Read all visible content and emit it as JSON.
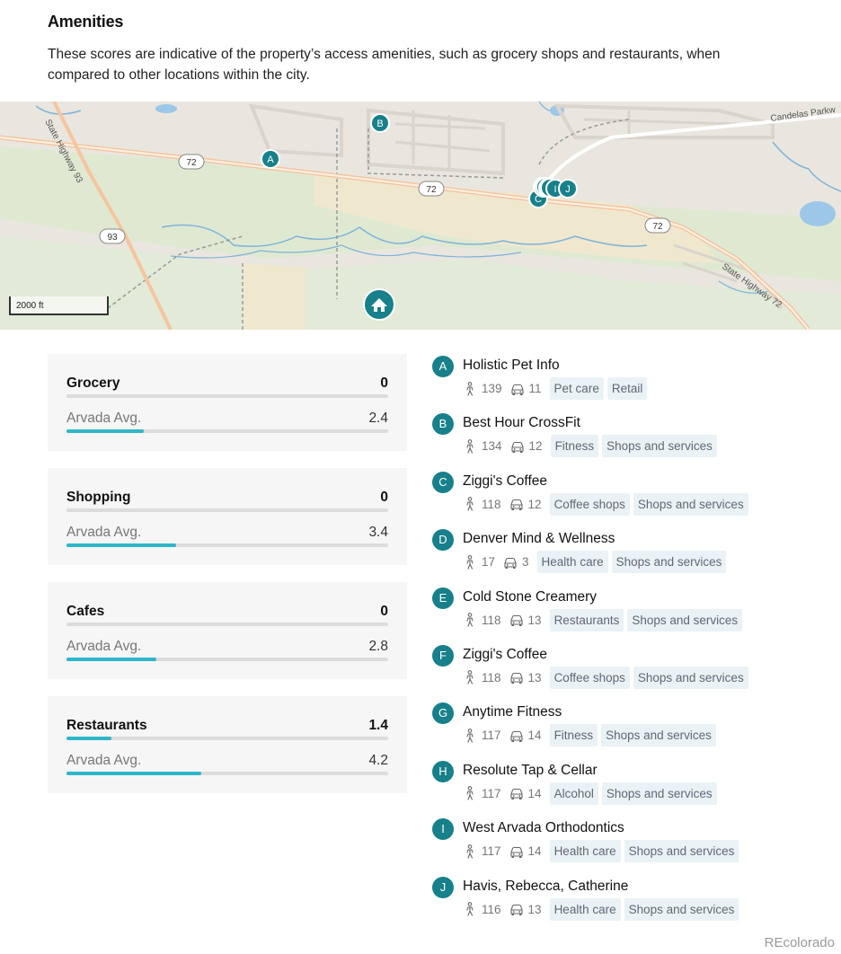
{
  "header": {
    "title": "Amenities",
    "description": "These scores are indicative of the property’s access amenities, such as grocery shops and restaurants, when compared to other locations within the city."
  },
  "map": {
    "scale_label": "2000 ft",
    "road_labels": [
      "72",
      "72",
      "72",
      "93",
      "State Highway 93",
      "State Highway 72",
      "Candelas Parkway"
    ],
    "markers": [
      "A",
      "B",
      "C",
      "D",
      "E",
      "F",
      "G",
      "H",
      "I",
      "J"
    ]
  },
  "scores": [
    {
      "category": "Grocery",
      "value": "0",
      "value_num": 0,
      "avg_label": "Arvada Avg.",
      "avg": "2.4",
      "avg_num": 2.4
    },
    {
      "category": "Shopping",
      "value": "0",
      "value_num": 0,
      "avg_label": "Arvada Avg.",
      "avg": "3.4",
      "avg_num": 3.4
    },
    {
      "category": "Cafes",
      "value": "0",
      "value_num": 0,
      "avg_label": "Arvada Avg.",
      "avg": "2.8",
      "avg_num": 2.8
    },
    {
      "category": "Restaurants",
      "value": "1.4",
      "value_num": 1.4,
      "avg_label": "Arvada Avg.",
      "avg": "4.2",
      "avg_num": 4.2
    }
  ],
  "score_max": 10,
  "amenities": [
    {
      "letter": "A",
      "name": "Holistic Pet Info",
      "walk": "139",
      "drive": "11",
      "tags": [
        "Pet care",
        "Retail"
      ]
    },
    {
      "letter": "B",
      "name": "Best Hour CrossFit",
      "walk": "134",
      "drive": "12",
      "tags": [
        "Fitness",
        "Shops and services"
      ]
    },
    {
      "letter": "C",
      "name": "Ziggi's Coffee",
      "walk": "118",
      "drive": "12",
      "tags": [
        "Coffee shops",
        "Shops and services"
      ]
    },
    {
      "letter": "D",
      "name": "Denver Mind & Wellness",
      "walk": "17",
      "drive": "3",
      "tags": [
        "Health care",
        "Shops and services"
      ]
    },
    {
      "letter": "E",
      "name": "Cold Stone Creamery",
      "walk": "118",
      "drive": "13",
      "tags": [
        "Restaurants",
        "Shops and services"
      ]
    },
    {
      "letter": "F",
      "name": "Ziggi's Coffee",
      "walk": "118",
      "drive": "13",
      "tags": [
        "Coffee shops",
        "Shops and services"
      ]
    },
    {
      "letter": "G",
      "name": "Anytime Fitness",
      "walk": "117",
      "drive": "14",
      "tags": [
        "Fitness",
        "Shops and services"
      ]
    },
    {
      "letter": "H",
      "name": "Resolute Tap & Cellar",
      "walk": "117",
      "drive": "14",
      "tags": [
        "Alcohol",
        "Shops and services"
      ]
    },
    {
      "letter": "I",
      "name": "West Arvada Orthodontics",
      "walk": "117",
      "drive": "14",
      "tags": [
        "Health care",
        "Shops and services"
      ]
    },
    {
      "letter": "J",
      "name": "Havis, Rebecca, Catherine",
      "walk": "116",
      "drive": "13",
      "tags": [
        "Health care",
        "Shops and services"
      ]
    }
  ],
  "footer": {
    "brand": "REcolorado"
  },
  "colors": {
    "accent": "#17808a",
    "bar_fill": "#2fb6c8",
    "tag_bg": "#eaf2f5"
  },
  "icons": {
    "walk": "walking-person-icon",
    "drive": "car-icon",
    "home": "home-icon"
  }
}
